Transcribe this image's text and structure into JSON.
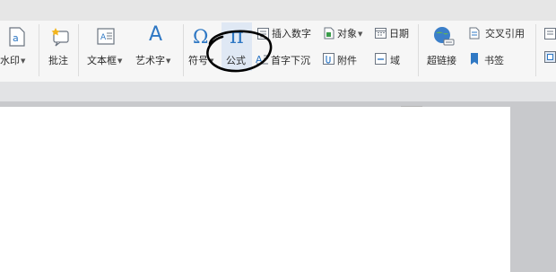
{
  "ribbon": {
    "watermark": {
      "label": "水印",
      "icon": "watermark-icon"
    },
    "comment": {
      "label": "批注",
      "icon": "comment-icon"
    },
    "textbox": {
      "label": "文本框",
      "icon": "textbox-icon"
    },
    "wordart": {
      "label": "艺术字",
      "icon": "wordart-icon",
      "glyph": "A"
    },
    "symbol": {
      "label": "符号",
      "icon": "omega-icon",
      "glyph": "Ω"
    },
    "formula": {
      "label": "公式",
      "icon": "pi-icon",
      "glyph": "π"
    },
    "insert_number": {
      "label": "插入数字",
      "icon": "number-icon"
    },
    "dropcap": {
      "label": "首字下沉",
      "icon": "dropcap-icon"
    },
    "object": {
      "label": "对象",
      "icon": "object-icon"
    },
    "attachment": {
      "label": "附件",
      "icon": "attachment-icon"
    },
    "date": {
      "label": "日期",
      "icon": "calendar-icon"
    },
    "field": {
      "label": "域",
      "icon": "field-icon"
    },
    "hyperlink": {
      "label": "超链接",
      "icon": "globe-link-icon"
    },
    "crossref": {
      "label": "交叉引用",
      "icon": "crossref-icon"
    },
    "bookmark": {
      "label": "书签",
      "icon": "bookmark-icon"
    }
  },
  "colors": {
    "accent": "#2f78c4",
    "ribbon_bg": "#f6f6f6",
    "workspace_bg": "#c8c9cc",
    "highlight": "#dfe8f4"
  }
}
